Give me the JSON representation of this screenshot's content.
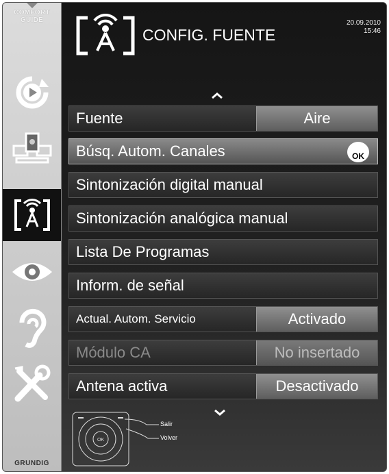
{
  "comfort_guide": {
    "line1": "COMFORT",
    "line2": "GUIDE"
  },
  "brand": "GRUNDIG",
  "header": {
    "title": "CONFIG. FUENTE",
    "date": "20.09.2010",
    "time": "15:46"
  },
  "menu": [
    {
      "label": "Fuente",
      "value": "Aire"
    },
    {
      "label": "Búsq. Autom. Canales",
      "ok": "OK"
    },
    {
      "label": "Sintonización digital manual"
    },
    {
      "label": "Sintonización analógica manual"
    },
    {
      "label": "Lista De Programas"
    },
    {
      "label": "Inform. de señal"
    },
    {
      "label": "Actual. Autom. Servicio",
      "value": "Activado"
    },
    {
      "label": "Módulo CA",
      "value": "No insertado"
    },
    {
      "label": "Antena activa",
      "value": "Desactivado"
    }
  ],
  "legend": {
    "exit": "Salir",
    "back": "Volver",
    "ok": "OK"
  },
  "sidebar_icons": [
    "source-refresh-icon",
    "network-devices-icon",
    "antenna-source-icon",
    "eye-picture-icon",
    "ear-sound-icon",
    "tools-settings-icon"
  ],
  "colors": {
    "background": "#1c1c1c",
    "selected_row": "#8a8a8a",
    "value_box": "#909090",
    "sidebar": "#d0d0d0"
  }
}
